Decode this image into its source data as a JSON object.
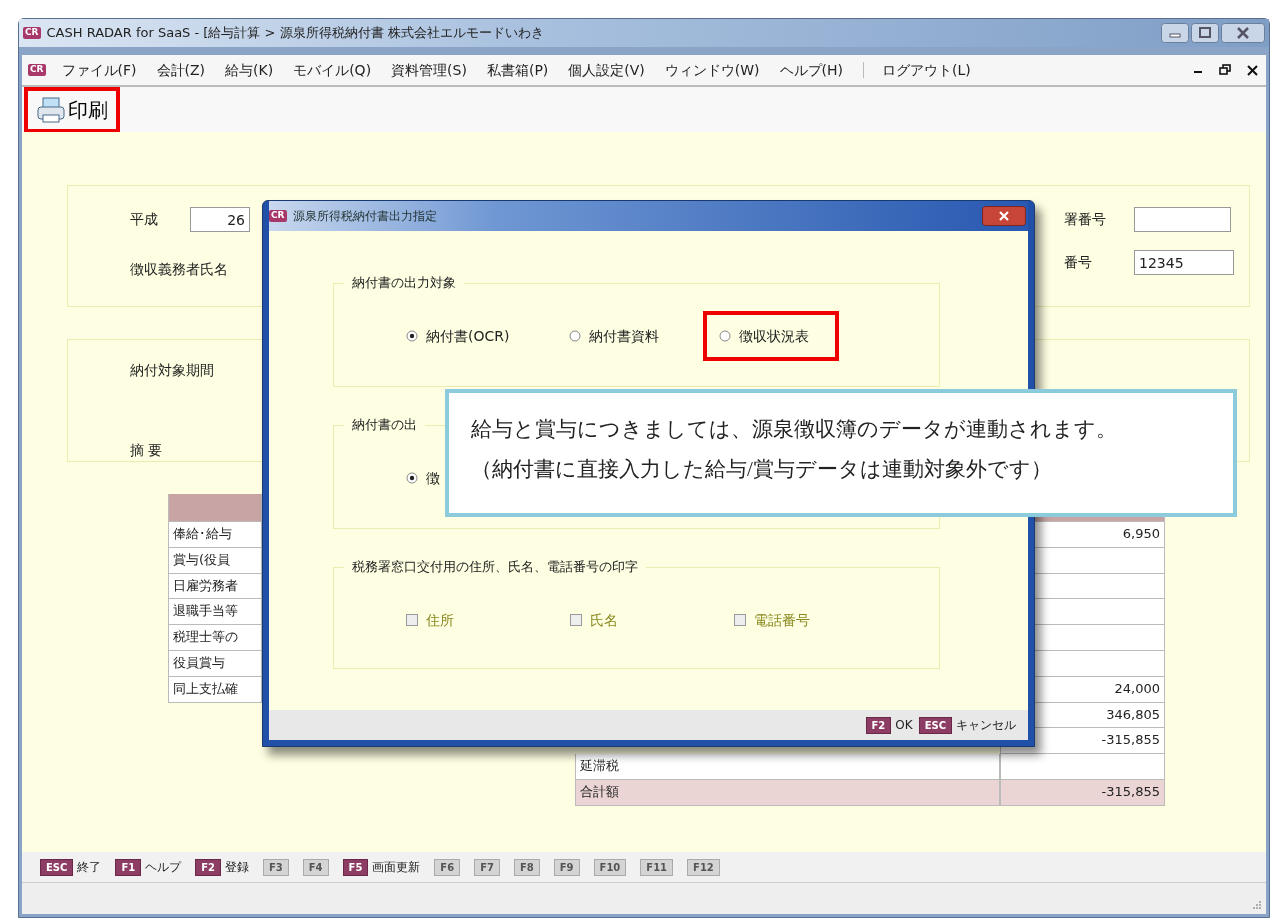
{
  "window": {
    "icon_text": "CR",
    "title": "CASH RADAR for SaaS - [給与計算 > 源泉所得税納付書 株式会社エルモードいわき"
  },
  "menu": {
    "icon_text": "CR",
    "items": [
      {
        "label": "ファイル(F)"
      },
      {
        "label": "会計(Z)"
      },
      {
        "label": "給与(K)"
      },
      {
        "label": "モバイル(Q)"
      },
      {
        "label": "資料管理(S)"
      },
      {
        "label": "私書箱(P)"
      },
      {
        "label": "個人設定(V)"
      },
      {
        "label": "ウィンドウ(W)"
      },
      {
        "label": "ヘルプ(H)"
      }
    ],
    "logout": "ログアウト(L)"
  },
  "toolbar": {
    "print_label": "印刷",
    "highlighted": true
  },
  "header_panel": {
    "era_label": "平成",
    "era_year": "26",
    "payer_label": "徴収義務者氏名",
    "office_label": "署番号",
    "ref_label": "番号",
    "ref_number": "12345"
  },
  "period_panel": {
    "period_label": "納付対象期間",
    "summary_label": "摘 要"
  },
  "tax_table": {
    "left_rows": [
      "俸給･給与",
      "賞与(役員",
      "日雇労務者",
      "退職手当等",
      "税理士等の",
      "役員賞与",
      "同上支払確"
    ],
    "right_cells": [
      {
        "value": "6,950"
      },
      {},
      {},
      {},
      {},
      {},
      {
        "value": "24,000"
      },
      {
        "value": "346,805"
      },
      {
        "value": "-315,855"
      },
      {},
      {
        "value": "-315,855",
        "highlight": true
      }
    ],
    "lower_rows": [
      {
        "label": "延滞税",
        "highlight": false
      },
      {
        "label": "合計額",
        "highlight": true
      }
    ]
  },
  "dialog": {
    "icon_text": "CR",
    "title": "源泉所得税納付書出力指定",
    "groups": [
      {
        "title": "納付書の出力対象",
        "options": [
          {
            "kind": "radio",
            "label": "納付書(OCR)",
            "selected": true,
            "highlighted": false
          },
          {
            "kind": "radio",
            "label": "納付書資料",
            "selected": false,
            "highlighted": false
          },
          {
            "kind": "radio",
            "label": "徴収状況表",
            "selected": false,
            "highlighted": true
          }
        ]
      },
      {
        "title": "納付書の出",
        "options": [
          {
            "kind": "radio",
            "label": "徴",
            "selected": true,
            "highlighted": false
          }
        ]
      },
      {
        "title": "税務署窓口交付用の住所、氏名、電話番号の印字",
        "options": [
          {
            "kind": "checkbox",
            "label": "住所",
            "checked": false,
            "disabled": true
          },
          {
            "kind": "checkbox",
            "label": "氏名",
            "checked": false,
            "disabled": true
          },
          {
            "kind": "checkbox",
            "label": "電話番号",
            "checked": false,
            "disabled": true
          }
        ]
      }
    ],
    "footer_keys": [
      {
        "key": "F2",
        "label": "OK"
      },
      {
        "key": "ESC",
        "label": "キャンセル"
      }
    ]
  },
  "callout": {
    "lines": [
      "給与と賞与につきましては、源泉徴収簿のデータが連動されます。",
      "（納付書に直接入力した給与/賞与データは連動対象外です）"
    ]
  },
  "function_keys": [
    {
      "key": "ESC",
      "label": "終了",
      "enabled": true
    },
    {
      "key": "F1",
      "label": "ヘルプ",
      "enabled": true
    },
    {
      "key": "F2",
      "label": "登録",
      "enabled": true
    },
    {
      "key": "F3",
      "enabled": false
    },
    {
      "key": "F4",
      "enabled": false
    },
    {
      "key": "F5",
      "label": "画面更新",
      "enabled": true
    },
    {
      "key": "F6",
      "enabled": false
    },
    {
      "key": "F7",
      "enabled": false
    },
    {
      "key": "F8",
      "enabled": false
    },
    {
      "key": "F9",
      "enabled": false
    },
    {
      "key": "F10",
      "enabled": false
    },
    {
      "key": "F11",
      "enabled": false
    },
    {
      "key": "F12",
      "enabled": false
    }
  ]
}
